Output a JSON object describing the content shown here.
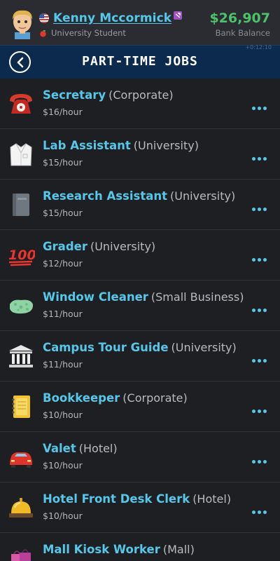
{
  "header": {
    "player_name": "Kenny Mccormick",
    "occupation": "University Student",
    "balance": "$26,907",
    "balance_label": "Bank Balance",
    "time_stamp": "+0:12:10"
  },
  "titlebar": {
    "title": "PART-TIME JOBS"
  },
  "jobs": [
    {
      "title": "Secretary",
      "employer": "(Corporate)",
      "pay": "$16/hour",
      "icon": "telephone-icon"
    },
    {
      "title": "Lab Assistant",
      "employer": "(University)",
      "pay": "$15/hour",
      "icon": "lab-coat-icon"
    },
    {
      "title": "Research Assistant",
      "employer": "(University)",
      "pay": "$15/hour",
      "icon": "notebook-icon"
    },
    {
      "title": "Grader",
      "employer": "(University)",
      "pay": "$12/hour",
      "icon": "hundred-points-icon"
    },
    {
      "title": "Window Cleaner",
      "employer": "(Small Business)",
      "pay": "$11/hour",
      "icon": "sponge-icon"
    },
    {
      "title": "Campus Tour Guide",
      "employer": "(University)",
      "pay": "$11/hour",
      "icon": "classical-building-icon"
    },
    {
      "title": "Bookkeeper",
      "employer": "(Corporate)",
      "pay": "$10/hour",
      "icon": "ledger-icon"
    },
    {
      "title": "Valet",
      "employer": "(Hotel)",
      "pay": "$10/hour",
      "icon": "car-icon"
    },
    {
      "title": "Hotel Front Desk Clerk",
      "employer": "(Hotel)",
      "pay": "$10/hour",
      "icon": "bellhop-bell-icon"
    },
    {
      "title": "Mall Kiosk Worker",
      "employer": "(Mall)",
      "pay": "",
      "icon": "shopping-bags-icon"
    }
  ],
  "colors": {
    "accent": "#56c7e8",
    "money": "#4cc26a",
    "titlebar": "#0c2a4d",
    "background": "#1e1f22"
  }
}
